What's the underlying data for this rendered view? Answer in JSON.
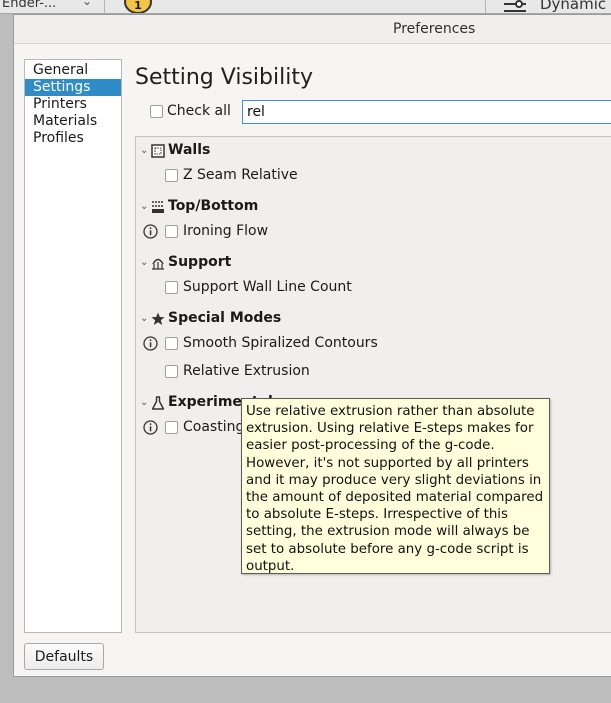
{
  "background_app": {
    "printer_selector": "Ender-...",
    "extruder_badge": "1",
    "profile_label": "Dynamic"
  },
  "dialog": {
    "title": "Preferences",
    "nav": [
      {
        "label": "General",
        "active": false
      },
      {
        "label": "Settings",
        "active": true
      },
      {
        "label": "Printers",
        "active": false
      },
      {
        "label": "Materials",
        "active": false
      },
      {
        "label": "Profiles",
        "active": false
      }
    ],
    "defaults_button": "Defaults"
  },
  "settings": {
    "heading": "Setting Visibility",
    "check_all_label": "Check all",
    "filter_value": "rel",
    "categories": [
      {
        "label": "Walls",
        "icon": "walls-icon",
        "items": [
          {
            "label": "Z Seam Relative",
            "info": false,
            "checked": false
          }
        ]
      },
      {
        "label": "Top/Bottom",
        "icon": "top-bottom-icon",
        "items": [
          {
            "label": "Ironing Flow",
            "info": true,
            "checked": false
          }
        ]
      },
      {
        "label": "Support",
        "icon": "support-icon",
        "items": [
          {
            "label": "Support Wall Line Count",
            "info": false,
            "checked": false
          }
        ]
      },
      {
        "label": "Special Modes",
        "icon": "star-icon",
        "items": [
          {
            "label": "Smooth Spiralized Contours",
            "info": true,
            "checked": false
          },
          {
            "label": "Relative Extrusion",
            "info": false,
            "checked": false
          }
        ]
      },
      {
        "label": "Experimental",
        "icon": "flask-icon",
        "items": [
          {
            "label": "Coasting",
            "info": true,
            "checked": false
          }
        ]
      }
    ]
  },
  "tooltip": {
    "lines": [
      "Use relative extrusion rather than absolute",
      "extrusion. Using relative E-steps makes for",
      "easier post-processing of the g-code.",
      "However, it's not supported by all printers",
      "and it may produce very slight deviations in",
      "the amount of deposited material compared",
      "to absolute E-steps. Irrespective of this",
      "setting, the extrusion mode will always be",
      "set to absolute before any g-code script is",
      "output."
    ]
  },
  "colors": {
    "selection": "#308cc6",
    "tooltip_bg": "#ffffdc",
    "focus_border": "#4a90d9"
  }
}
